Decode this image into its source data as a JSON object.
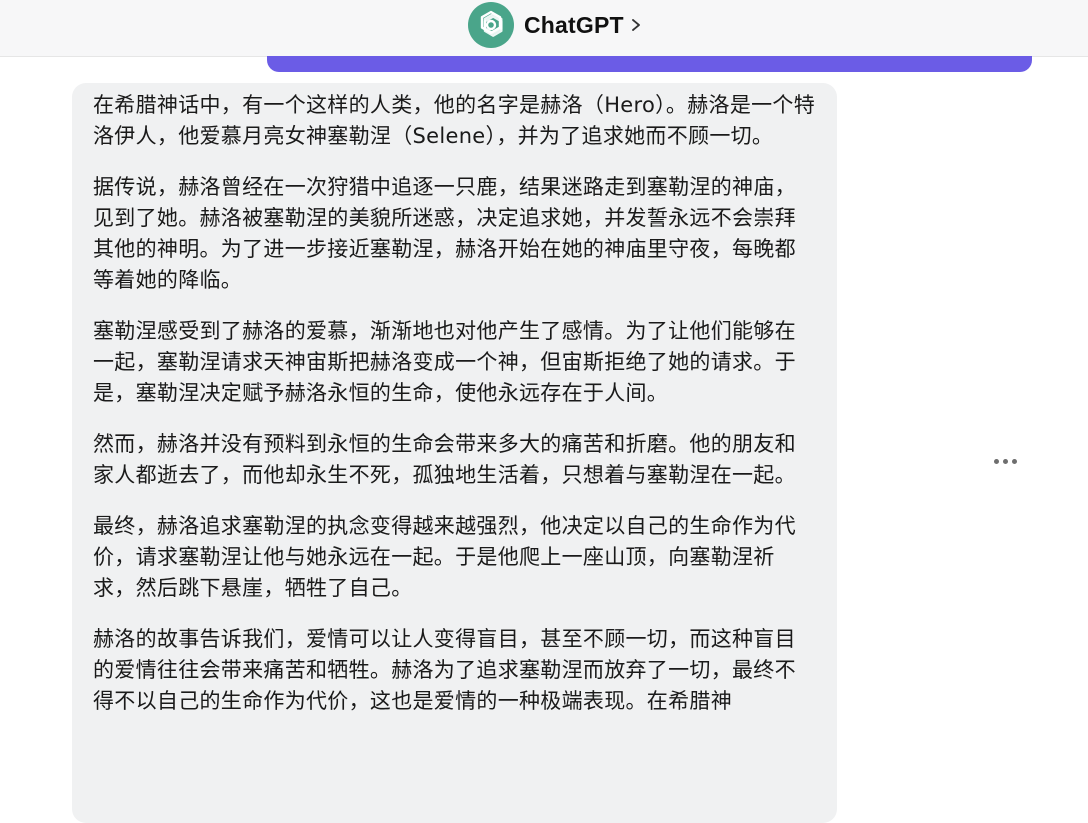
{
  "header": {
    "title": "ChatGPT",
    "logo_icon": "openai-logo-icon",
    "chevron_icon": "chevron-right-icon",
    "logo_color": "#4aa58a"
  },
  "accent": {
    "purple_bar_color": "#6b5ce6"
  },
  "message": {
    "paragraphs": [
      "在希腊神话中，有一个这样的人类，他的名字是赫洛（Hero）。赫洛是一个特洛伊人，他爱慕月亮女神塞勒涅（Selene），并为了追求她而不顾一切。",
      "据传说，赫洛曾经在一次狩猎中追逐一只鹿，结果迷路走到塞勒涅的神庙，见到了她。赫洛被塞勒涅的美貌所迷惑，决定追求她，并发誓永远不会崇拜其他的神明。为了进一步接近塞勒涅，赫洛开始在她的神庙里守夜，每晚都等着她的降临。",
      "塞勒涅感受到了赫洛的爱慕，渐渐地也对他产生了感情。为了让他们能够在一起，塞勒涅请求天神宙斯把赫洛变成一个神，但宙斯拒绝了她的请求。于是，塞勒涅决定赋予赫洛永恒的生命，使他永远存在于人间。",
      "然而，赫洛并没有预料到永恒的生命会带来多大的痛苦和折磨。他的朋友和家人都逝去了，而他却永生不死，孤独地生活着，只想着与塞勒涅在一起。",
      "最终，赫洛追求塞勒涅的执念变得越来越强烈，他决定以自己的生命作为代价，请求塞勒涅让他与她永远在一起。于是他爬上一座山顶，向塞勒涅祈求，然后跳下悬崖，牺牲了自己。",
      "赫洛的故事告诉我们，爱情可以让人变得盲目，甚至不顾一切，而这种盲目的爱情往往会带来痛苦和牺牲。赫洛为了追求塞勒涅而放弃了一切，最终不得不以自己的生命作为代价，这也是爱情的一种极端表现。在希腊神"
    ]
  },
  "actions": {
    "more_icon": "more-horizontal-icon"
  }
}
